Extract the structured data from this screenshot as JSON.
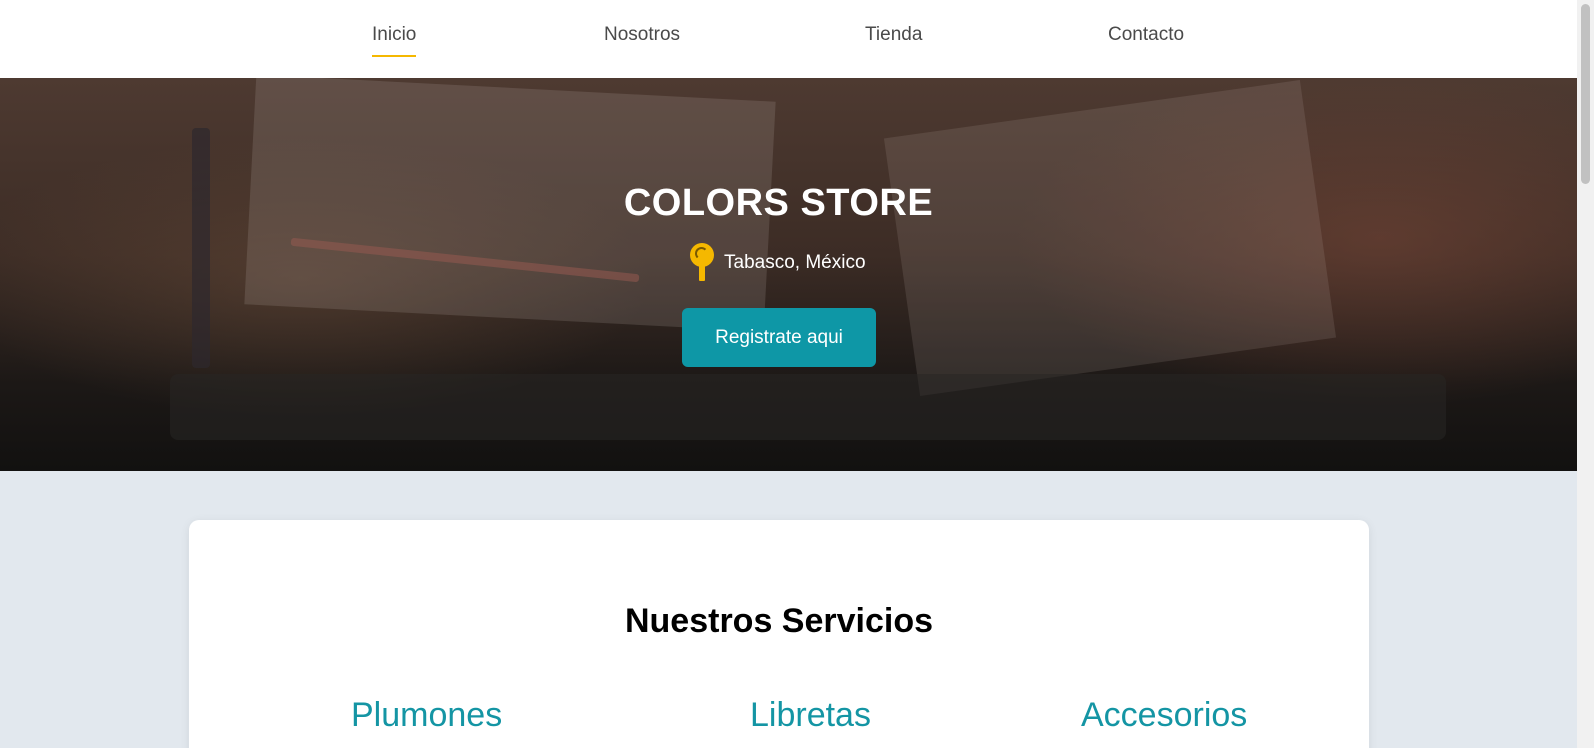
{
  "nav": {
    "items": [
      {
        "label": "Inicio",
        "active": true
      },
      {
        "label": "Nosotros",
        "active": false
      },
      {
        "label": "Tienda",
        "active": false
      },
      {
        "label": "Contacto",
        "active": false
      }
    ],
    "active_underline_color": "#f5b800"
  },
  "hero": {
    "title": "COLORS STORE",
    "location": "Tabasco, México",
    "location_icon": "map-pin-icon",
    "register_button": "Registrate aqui",
    "button_color": "#0e97a6"
  },
  "services": {
    "title": "Nuestros Servicios",
    "items": [
      "Plumones",
      "Libretas",
      "Accesorios"
    ],
    "item_color": "#1495a4"
  }
}
